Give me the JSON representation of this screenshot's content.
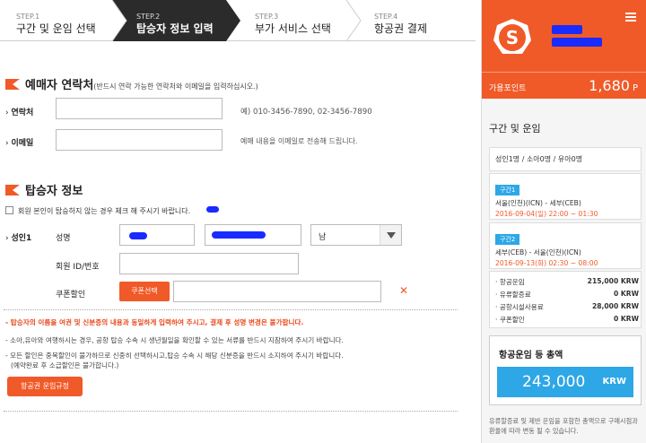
{
  "steps": [
    {
      "num": "STEP.1",
      "label": "구간 및 운임 선택",
      "active": false
    },
    {
      "num": "STEP.2",
      "label": "탑승자 정보 입력",
      "active": true
    },
    {
      "num": "STEP.3",
      "label": "부가 서비스 선택",
      "active": false
    },
    {
      "num": "STEP.4",
      "label": "항공권 결제",
      "active": false
    }
  ],
  "contact": {
    "title": "예매자 연락처",
    "note": "(반드시 연락 가능한 연락처와 이메일을 입력하십시오.)",
    "phone_label": "연락처",
    "phone_hint": "예) 010-3456-7890, 02-3456-7890",
    "email_label": "이메일",
    "email_hint": "예매 내용을 이메일로 전송해 드립니다."
  },
  "passenger": {
    "title": "탑승자 정보",
    "checkbox_label": "회원 본인이 탑승하지 않는 경우 체크 해 주시기 바랍니다.",
    "adult_label": "성인1",
    "name_label": "성명",
    "gender_value": "남",
    "member_id_label": "회원 ID/번호",
    "coupon_label": "쿠폰할인",
    "coupon_button": "쿠폰선택"
  },
  "notices": [
    "- 탑승자의 이름을 여권 및 신분증의 내용과 동일하게 입력하여 주시고, 결제 후 성명 변경은 불가합니다.",
    "- 소아,유아와 여행하시는 경우, 공항 탑승 수속 시 생년월일을 확인할 수 있는 서류를 반드시 지참하여 주시기 바랍니다.",
    "- 모든 할인은 중복할인이 불가하므로 신중히 선택하시고,탑승 수속 시 해당 신분증을 반드시 소지하여 주시기 바랍니다.",
    "(예약완료 후 소급할인은 불가합니다.)"
  ],
  "fare_rules_button": "항공권 운임규정",
  "sidebar": {
    "points_label": "가용포인트",
    "points_value": "1,680",
    "points_unit": "P",
    "heading": "구간 및 운임",
    "pax_summary": "성인1명 / 소아0명 / 유아0명",
    "segments": [
      {
        "badge": "구간1",
        "route": "서울(인천)(ICN) - 세부(CEB)",
        "date": "2016-09-04(일) 22:00 ~ 01:30"
      },
      {
        "badge": "구간2",
        "route": "세부(CEB) - 서울(인천)(ICN)",
        "date": "2016-09-13(화) 02:30 ~ 08:00"
      }
    ],
    "fares": [
      {
        "label": "· 항공운임",
        "value": "215,000 KRW"
      },
      {
        "label": "· 유류할증료",
        "value": "0 KRW"
      },
      {
        "label": "· 공항시설사용료",
        "value": "28,000 KRW"
      },
      {
        "label": "· 쿠폰할인",
        "value": "0 KRW"
      }
    ],
    "total_label": "항공운임 등 총액",
    "total_value": "243,000",
    "total_currency": "KRW",
    "note": "유류할증료 및 제반 운임을 포함한 총액으로 구매시점과 환율에 따라 변동 될 수 있습니다."
  },
  "colors": {
    "accent": "#f05a28",
    "blue": "#2da7e6",
    "step_active": "#2b2b2b"
  }
}
